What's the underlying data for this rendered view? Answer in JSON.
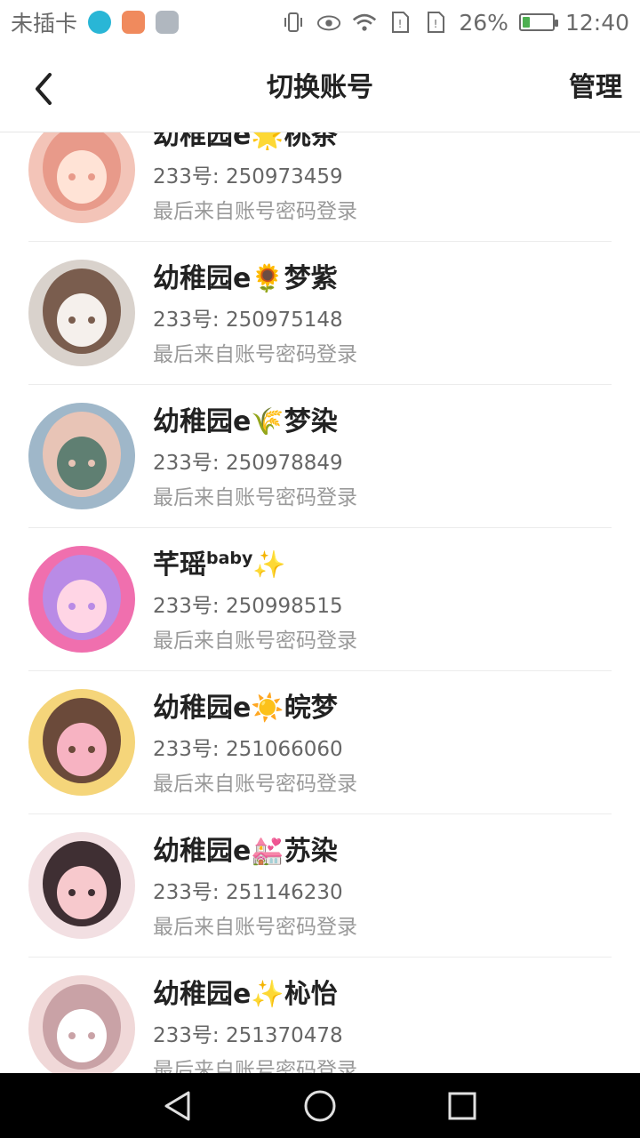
{
  "status_bar": {
    "carrier": "未插卡",
    "battery_percent": "26%",
    "battery_level": 0.26,
    "time": "12:40",
    "icons": [
      "moon-app-icon",
      "orange-app-icon",
      "gallery-app-icon",
      "vibrate-icon",
      "eye-icon",
      "wifi-icon",
      "sim-icon",
      "sim-icon",
      "battery-charging-icon"
    ]
  },
  "header": {
    "back_icon": "chevron-left-icon",
    "title": "切换账号",
    "manage_label": "管理"
  },
  "accounts": [
    {
      "name": "幼稚园e🌟桃茶",
      "id_text": "233号: 250973459",
      "last_login": "最后来自账号密码登录",
      "avatar_colors": [
        "#f3c4b8",
        "#e89a8a",
        "#ffe3d6"
      ]
    },
    {
      "name": "幼稚园e🌻梦紫",
      "id_text": "233号: 250975148",
      "last_login": "最后来自账号密码登录",
      "avatar_colors": [
        "#d9d2cc",
        "#7a5d4e",
        "#f5f0ec"
      ]
    },
    {
      "name": "幼稚园e🌾梦染",
      "id_text": "233号: 250978849",
      "last_login": "最后来自账号密码登录",
      "avatar_colors": [
        "#9fb7c9",
        "#e8c4b6",
        "#5f7f72"
      ]
    },
    {
      "name": "芊瑶",
      "name_sup": "baby",
      "name_tail": "✨",
      "id_text": "233号: 250998515",
      "last_login": "最后来自账号密码登录",
      "avatar_colors": [
        "#f06fae",
        "#b98be6",
        "#ffd5e5"
      ]
    },
    {
      "name": "幼稚园e☀️皖梦",
      "id_text": "233号: 251066060",
      "last_login": "最后来自账号密码登录",
      "avatar_colors": [
        "#f5d57a",
        "#6b4a3a",
        "#f7b3c2"
      ]
    },
    {
      "name": "幼稚园e💒苏染",
      "id_text": "233号: 251146230",
      "last_login": "最后来自账号密码登录",
      "avatar_colors": [
        "#f2dfe2",
        "#3f2f33",
        "#f7c9cd"
      ]
    },
    {
      "name": "幼稚园e✨杺怡",
      "id_text": "233号: 251370478",
      "last_login": "最后来自账号密码登录",
      "avatar_colors": [
        "#f0d8d8",
        "#c9a2a6",
        "#ffffff"
      ]
    }
  ],
  "nav_bar": {
    "back": "triangle-back-icon",
    "home": "circle-home-icon",
    "recents": "square-recents-icon"
  }
}
